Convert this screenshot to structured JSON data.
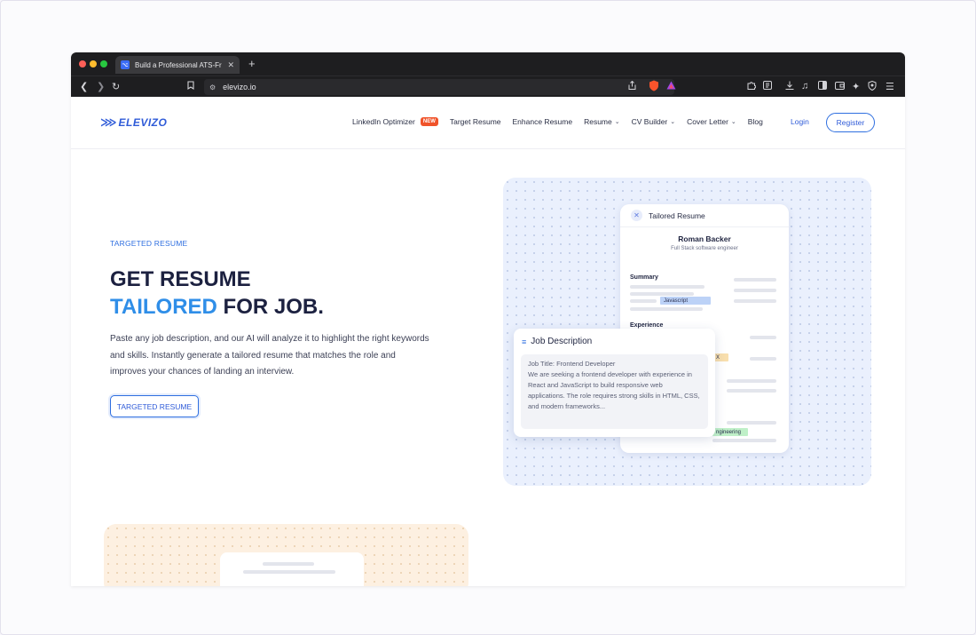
{
  "browser": {
    "tab_title": "Build a Professional ATS-Frien",
    "tab_favicon": "⌥",
    "url": "elevizo.io"
  },
  "nav": {
    "logo_text": "ELEVIZO",
    "links": [
      {
        "label": "LinkedIn Optimizer",
        "badge": "NEW"
      },
      {
        "label": "Target Resume"
      },
      {
        "label": "Enhance Resume"
      },
      {
        "label": "Resume",
        "dropdown": true
      },
      {
        "label": "CV Builder",
        "dropdown": true
      },
      {
        "label": "Cover Letter",
        "dropdown": true
      },
      {
        "label": "Blog"
      }
    ],
    "login": "Login",
    "register": "Register"
  },
  "hero": {
    "eyebrow": "TARGETED RESUME",
    "headline_line1": "GET RESUME",
    "headline_accent": "TAILORED",
    "headline_rest": " FOR JOB.",
    "description": "Paste any job description, and our AI will analyze it to highlight the right keywords and skills. Instantly generate a tailored resume that matches the role and improves your chances of landing an interview.",
    "button": "TARGETED RESUME"
  },
  "resume_card": {
    "title": "Tailored Resume",
    "name": "Roman Backer",
    "role": "Full Stack software engineer",
    "section_summary": "Summary",
    "section_experience": "Experience",
    "highlight_javascript": "Javascript",
    "highlight_x": "X",
    "highlight_engineering": "ngineering"
  },
  "job_card": {
    "title": "Job Description",
    "body": "Job Title: Frontend Developer\nWe are seeking a frontend developer with experience in React and JavaScript to build responsive web applications. The role requires strong skills in HTML, CSS, and modern frameworks..."
  },
  "colors": {
    "accent": "#2f6fe0",
    "headline": "#1c2140",
    "new_badge": "#f0532a"
  }
}
